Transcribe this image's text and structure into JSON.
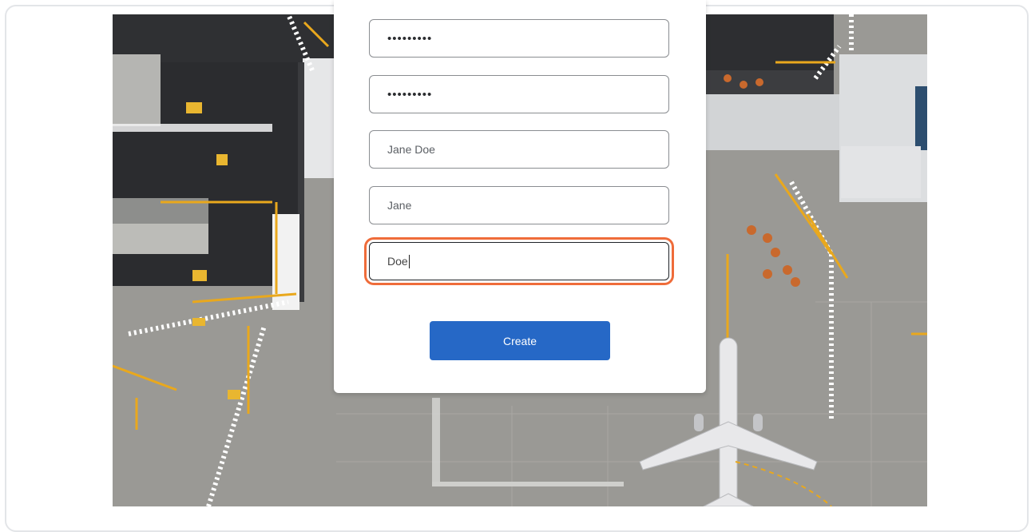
{
  "form": {
    "password_value": "•••••••••",
    "confirm_password_value": "•••••••••",
    "display_name_value": "Jane Doe",
    "first_name_value": "Jane",
    "last_name_value": "Doe",
    "create_button_label": "Create"
  },
  "colors": {
    "button": "#2668c6",
    "focus_ring": "#ef6c3a"
  },
  "background": {
    "image": "aerial-airport-apron"
  }
}
